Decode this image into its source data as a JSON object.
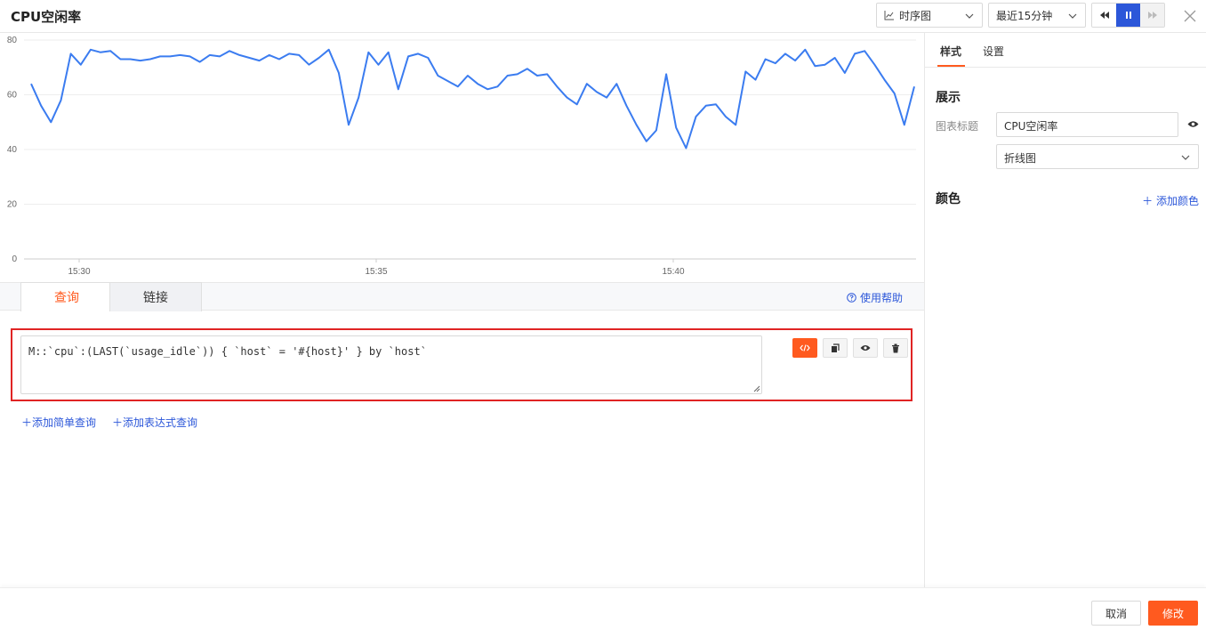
{
  "header": {
    "title": "CPU空闲率",
    "chart_type_select": "时序图",
    "time_range_select": "最近15分钟"
  },
  "colors": {
    "accent": "#ff5a1f",
    "primary": "#2c57d9",
    "line": "#3b7cf0",
    "highlight_border": "#e02424"
  },
  "chart_data": {
    "type": "line",
    "x_ticks": [
      "15:30",
      "15:35",
      "15:40"
    ],
    "ylim": [
      0,
      80
    ],
    "y_ticks": [
      "0",
      "20",
      "40",
      "60",
      "80"
    ],
    "grid": true,
    "series": [
      {
        "values": [
          64,
          56,
          50,
          58,
          75,
          71,
          76.5,
          75.5,
          76,
          73,
          73,
          72.5,
          73,
          74,
          74,
          74.5,
          74,
          72,
          74.5,
          74,
          76,
          74.5,
          73.5,
          72.5,
          74.5,
          73,
          75,
          74.5,
          71,
          73.5,
          76.5,
          68,
          49,
          59,
          75.5,
          71,
          75.5,
          62,
          74,
          75,
          73.5,
          67,
          65,
          63,
          67,
          64,
          62,
          63,
          67,
          67.5,
          69.5,
          67,
          67.5,
          63,
          59,
          56.5,
          64,
          61,
          59,
          64,
          56,
          49,
          43,
          47,
          67.5,
          48,
          40.5,
          52,
          56,
          56.5,
          52,
          49,
          68.5,
          65.5,
          73,
          71.5,
          75,
          72.5,
          76.5,
          70.5,
          71,
          73.5,
          68,
          75,
          76,
          71,
          65.5,
          60.5,
          49,
          63
        ]
      }
    ]
  },
  "query_tabs": [
    {
      "label": "查询",
      "active": true
    },
    {
      "label": "链接",
      "active": false
    }
  ],
  "help_link": "使用帮助",
  "query": {
    "text": "M::`cpu`:(LAST(`usage_idle`)) { `host` = '#{host}' } by `host`"
  },
  "add_links": {
    "simple": "添加简单查询",
    "expression": "添加表达式查询"
  },
  "right_panel": {
    "tabs": [
      {
        "label": "样式",
        "active": true
      },
      {
        "label": "设置",
        "active": false
      }
    ],
    "display_section": "展示",
    "chart_title_label": "图表标题",
    "chart_title_value": "CPU空闲率",
    "chart_style": "折线图",
    "color_section": "颜色",
    "add_color": "添加颜色"
  },
  "footer": {
    "cancel": "取消",
    "submit": "修改"
  }
}
